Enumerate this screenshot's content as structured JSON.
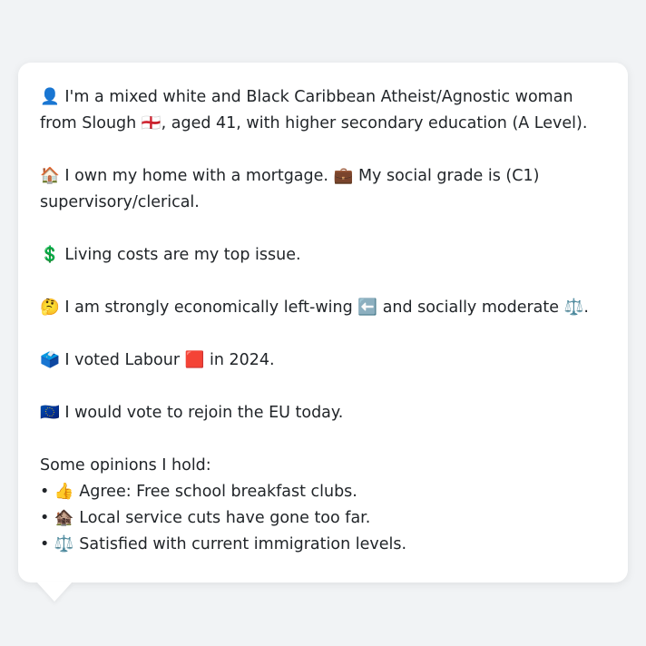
{
  "profile": {
    "intro": {
      "icon": "👤",
      "text": "I'm a mixed white and Black Caribbean Atheist/Agnostic woman from Slough",
      "flag": "🏴󠁧󠁢󠁥󠁮󠁧󠁿",
      "text_after": ", aged 41, with higher secondary education (A Level)."
    },
    "home": {
      "icon": "🏠",
      "text": "I own my home with a mortgage.",
      "grade_icon": "💼",
      "grade_text": "My social grade is (C1) supervisory/clerical."
    },
    "issue": {
      "icon": "💲",
      "text": "Living costs are my top issue."
    },
    "politics": {
      "icon": "🤔",
      "text_a": "I am strongly economically left-wing",
      "left_icon": "⬅️",
      "text_b": "and socially moderate",
      "moderate_icon": "⚖️",
      "text_end": "."
    },
    "vote": {
      "icon": "🗳️",
      "text_a": "I voted Labour",
      "party_icon": "🟥",
      "text_b": "in 2024."
    },
    "eu": {
      "icon": "🇪🇺",
      "text": "I would vote to rejoin the EU today."
    },
    "opinions": {
      "heading": "Some opinions I hold:",
      "bullet": "•",
      "items": [
        {
          "icon": "👍",
          "text": "Agree: Free school breakfast clubs."
        },
        {
          "icon": "🏚️",
          "text": "Local service cuts have gone too far."
        },
        {
          "icon": "⚖️",
          "text": "Satisfied with current immigration levels."
        }
      ]
    }
  }
}
